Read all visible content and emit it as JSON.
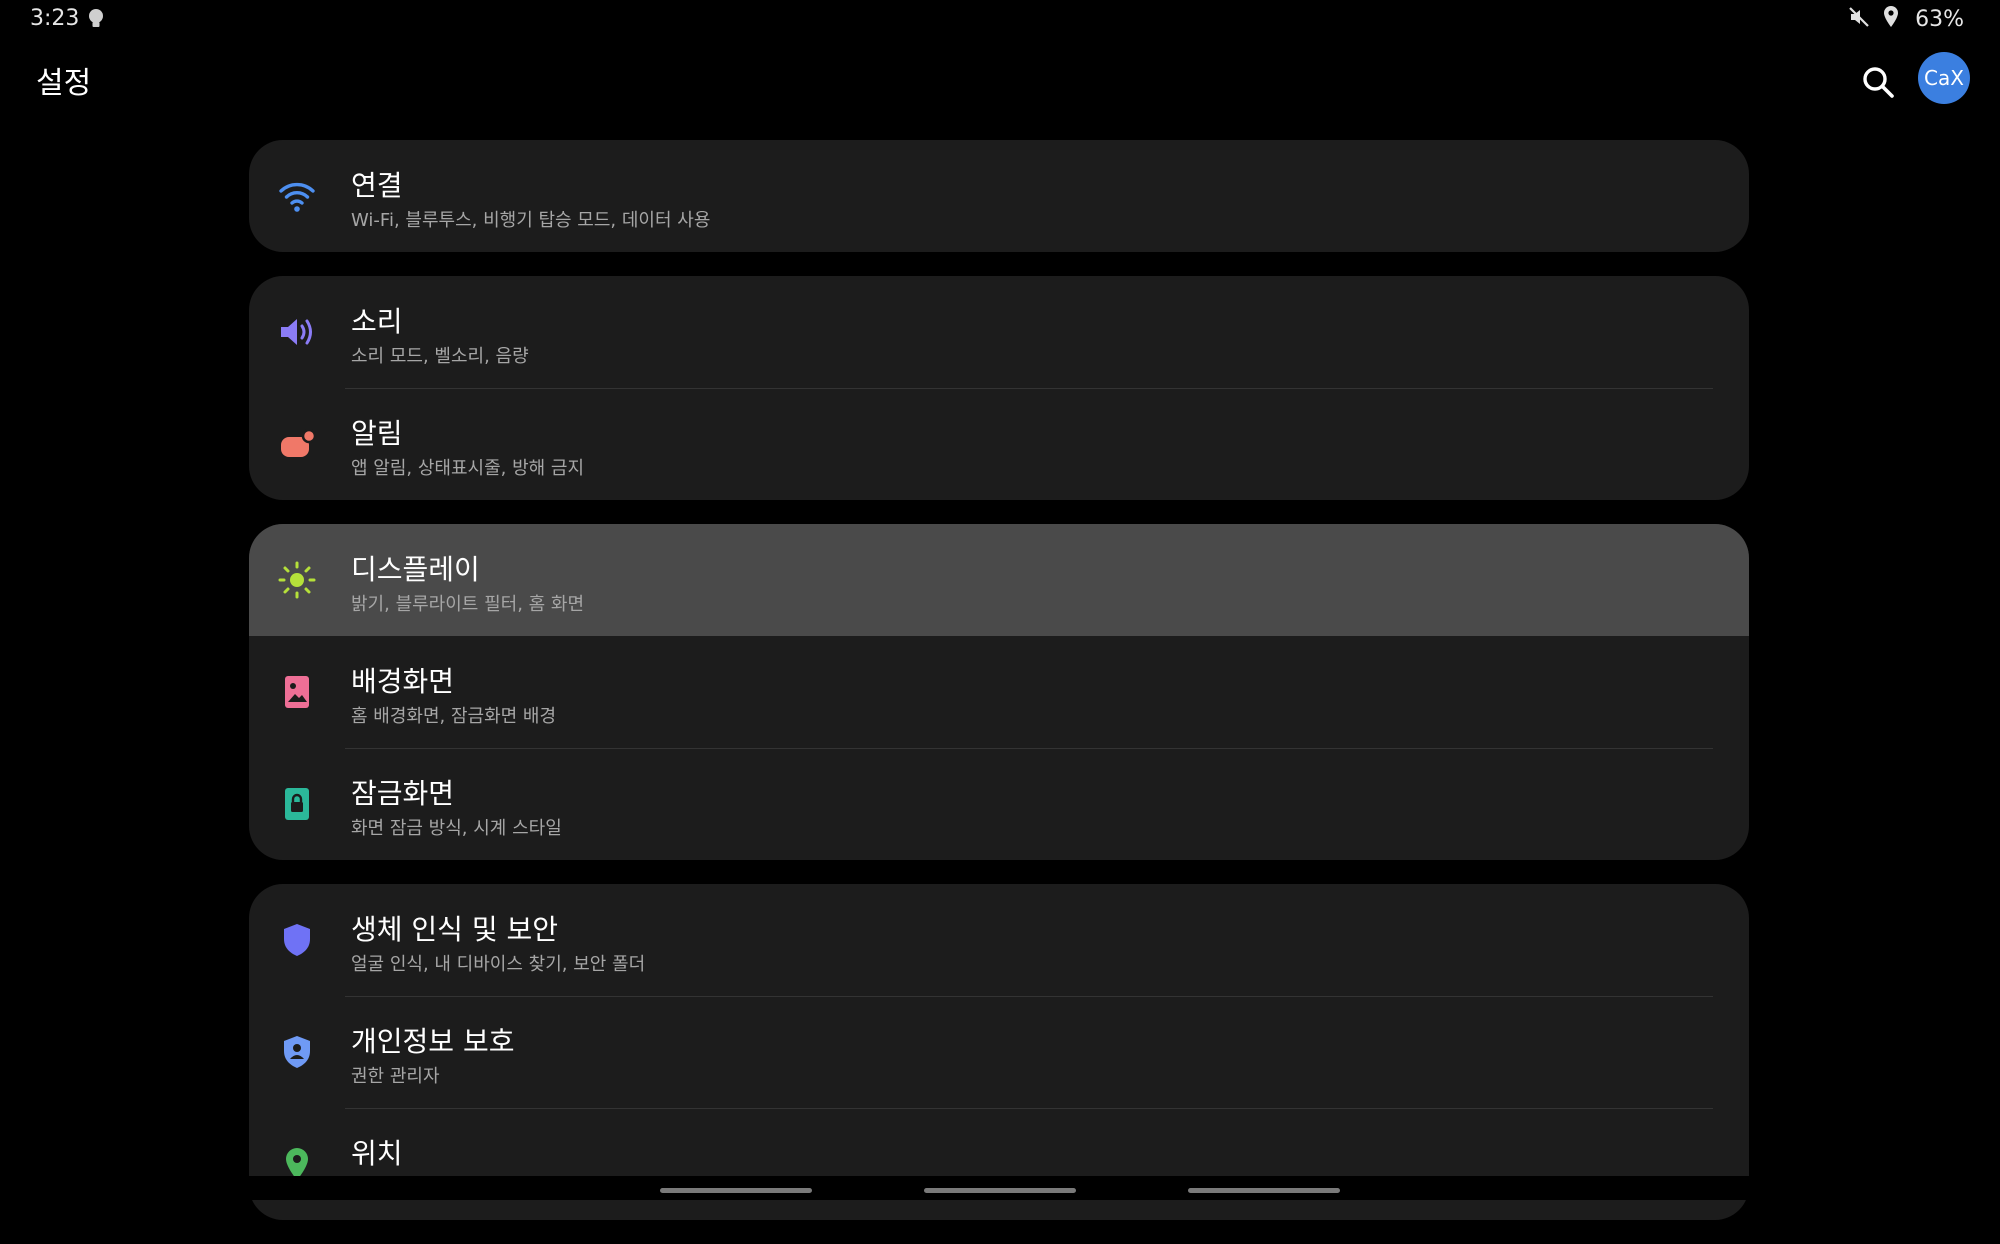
{
  "status_bar": {
    "time": "3:23",
    "battery": "63%",
    "icons": [
      "bulb-icon",
      "mute-icon",
      "location-icon"
    ]
  },
  "header": {
    "title": "설정",
    "avatar_text": "CaX"
  },
  "colors": {
    "background": "#000000",
    "card": "#1c1c1c",
    "highlight": "#4a4a4a",
    "wifi": "#4d8ff0",
    "sound": "#8b7cf6",
    "notification": "#f07868",
    "display": "#b5e03a",
    "wallpaper": "#ee6f96",
    "lockscreen": "#2bb89a",
    "security": "#6f72f5",
    "privacy": "#6f9af5",
    "location": "#4cb85c",
    "avatar": "#3b7fe0"
  },
  "settings": {
    "connections": {
      "title": "연결",
      "subtitle": "Wi-Fi, 블루투스, 비행기 탑승 모드, 데이터 사용",
      "icon": "wifi-icon"
    },
    "sound": {
      "title": "소리",
      "subtitle": "소리 모드, 벨소리, 음량",
      "icon": "speaker-icon"
    },
    "notifications": {
      "title": "알림",
      "subtitle": "앱 알림, 상태표시줄, 방해 금지",
      "icon": "notification-icon"
    },
    "display": {
      "title": "디스플레이",
      "subtitle": "밝기, 블루라이트 필터, 홈 화면",
      "icon": "sun-icon"
    },
    "wallpaper": {
      "title": "배경화면",
      "subtitle": "홈 배경화면, 잠금화면 배경",
      "icon": "wallpaper-icon"
    },
    "lockscreen": {
      "title": "잠금화면",
      "subtitle": "화면 잠금 방식, 시계 스타일",
      "icon": "lock-icon"
    },
    "security": {
      "title": "생체 인식 및 보안",
      "subtitle": "얼굴 인식, 내 디바이스 찾기, 보안 폴더",
      "icon": "shield-icon"
    },
    "privacy": {
      "title": "개인정보 보호",
      "subtitle": "권한 관리자",
      "icon": "privacy-shield-icon"
    },
    "location": {
      "title": "위치",
      "subtitle": "",
      "icon": "location-pin-icon"
    }
  }
}
